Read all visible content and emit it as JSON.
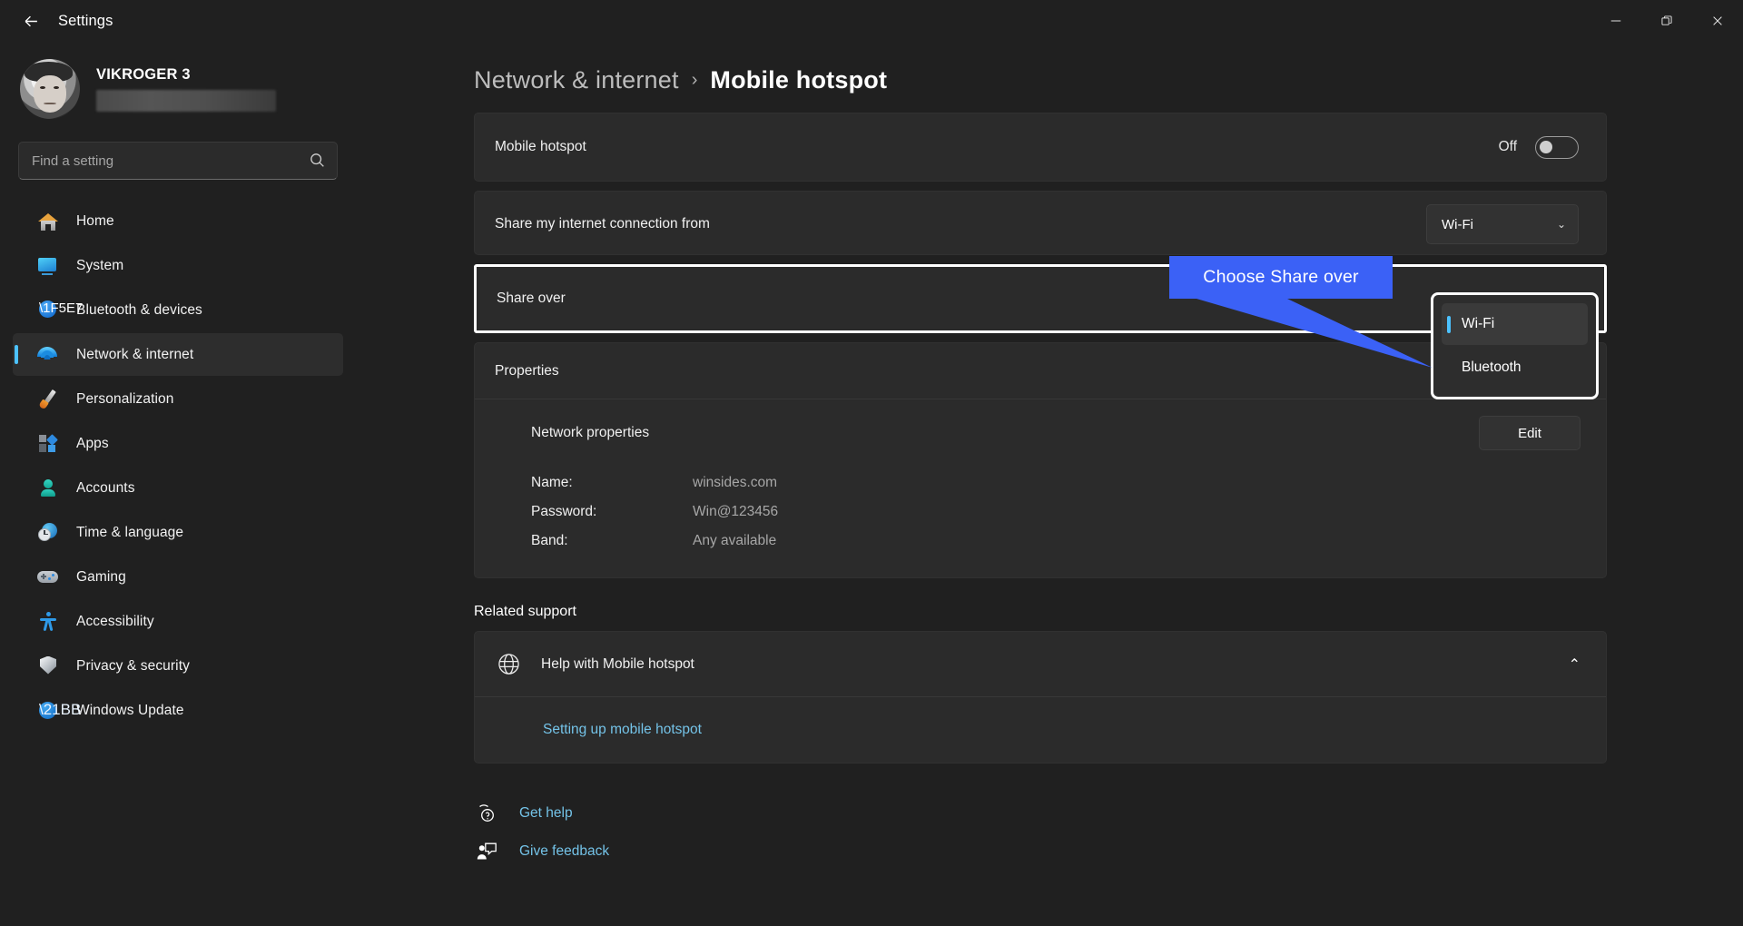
{
  "window": {
    "title": "Settings",
    "back_icon": "back-arrow-icon",
    "minimize_label": "Minimize",
    "maximize_label": "Restore",
    "close_label": "Close"
  },
  "sidebar": {
    "profile": {
      "name": "VIKROGER 3",
      "account_redacted": ""
    },
    "search": {
      "placeholder": "Find a setting",
      "value": "",
      "icon": "search-icon"
    },
    "items": [
      {
        "label": "Home",
        "icon": "home-icon",
        "selected": false
      },
      {
        "label": "System",
        "icon": "system-icon",
        "selected": false
      },
      {
        "label": "Bluetooth & devices",
        "icon": "bluetooth-icon",
        "selected": false
      },
      {
        "label": "Network & internet",
        "icon": "wifi-icon",
        "selected": true
      },
      {
        "label": "Personalization",
        "icon": "paintbrush-icon",
        "selected": false
      },
      {
        "label": "Apps",
        "icon": "apps-icon",
        "selected": false
      },
      {
        "label": "Accounts",
        "icon": "account-icon",
        "selected": false
      },
      {
        "label": "Time & language",
        "icon": "clock-globe-icon",
        "selected": false
      },
      {
        "label": "Gaming",
        "icon": "gamepad-icon",
        "selected": false
      },
      {
        "label": "Accessibility",
        "icon": "accessibility-icon",
        "selected": false
      },
      {
        "label": "Privacy & security",
        "icon": "shield-icon",
        "selected": false
      },
      {
        "label": "Windows Update",
        "icon": "update-icon",
        "selected": false
      }
    ]
  },
  "breadcrumb": {
    "parent": "Network & internet",
    "separator": "›",
    "current": "Mobile hotspot"
  },
  "mobile_hotspot": {
    "label": "Mobile hotspot",
    "state_text": "Off",
    "toggle_on": false
  },
  "share_from": {
    "label": "Share my internet connection from",
    "selected": "Wi-Fi",
    "chevron": "⌄",
    "options": [
      "Wi-Fi"
    ]
  },
  "share_over": {
    "label": "Share over",
    "highlighted": true,
    "dropdown_open": true,
    "options": [
      {
        "label": "Wi-Fi",
        "selected": true
      },
      {
        "label": "Bluetooth",
        "selected": false
      }
    ]
  },
  "properties": {
    "title": "Properties",
    "expanded": true,
    "chevron": "⌃",
    "subtitle": "Network properties",
    "edit_label": "Edit",
    "fields": [
      {
        "key": "Name:",
        "value": "winsides.com"
      },
      {
        "key": "Password:",
        "value": "Win@123456"
      },
      {
        "key": "Band:",
        "value": "Any available"
      }
    ]
  },
  "related_support": {
    "title": "Related support",
    "help_item": {
      "label": "Help with Mobile hotspot",
      "icon": "help-globe-icon",
      "chevron": "⌃"
    },
    "links": [
      {
        "label": "Setting up mobile hotspot"
      }
    ]
  },
  "footer_links": [
    {
      "label": "Get help",
      "icon": "get-help-icon"
    },
    {
      "label": "Give feedback",
      "icon": "feedback-icon"
    }
  ],
  "callout": {
    "text": "Choose Share over",
    "color": "#3b61f6"
  },
  "colors": {
    "accent": "#4cc2ff",
    "link": "#74c3e8",
    "background": "#202020",
    "card": "#2b2b2b",
    "highlight_border": "#ffffff",
    "callout": "#3b61f6"
  }
}
